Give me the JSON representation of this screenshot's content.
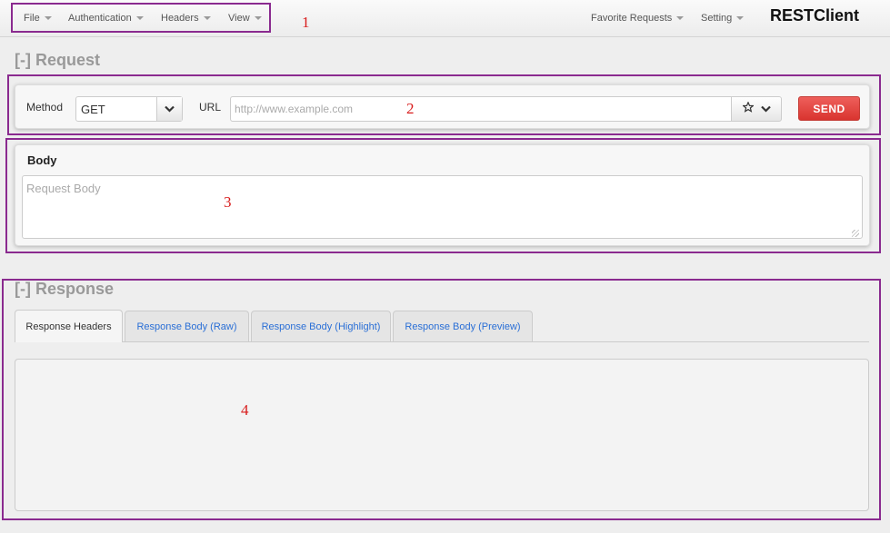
{
  "menu": {
    "left": [
      {
        "label": "File"
      },
      {
        "label": "Authentication"
      },
      {
        "label": "Headers"
      },
      {
        "label": "View"
      }
    ],
    "right": [
      {
        "label": "Favorite Requests"
      },
      {
        "label": "Setting"
      }
    ],
    "brand": "RESTClient"
  },
  "request": {
    "section_title": "[-] Request",
    "method_label": "Method",
    "method_value": "GET",
    "url_label": "URL",
    "url_placeholder": "http://www.example.com",
    "send_label": "SEND",
    "body_title": "Body",
    "body_placeholder": "Request Body"
  },
  "response": {
    "section_title": "[-] Response",
    "tabs": [
      {
        "label": "Response Headers"
      },
      {
        "label": "Response Body (Raw)"
      },
      {
        "label": "Response Body (Highlight)"
      },
      {
        "label": "Response Body (Preview)"
      }
    ]
  },
  "annotations": {
    "markers": [
      "1",
      "2",
      "3",
      "4"
    ],
    "box_color": "#8a2a8f",
    "number_color": "#d81b1b"
  },
  "colors": {
    "send_button": "#d9342f",
    "tab_link": "#2a6fd6",
    "background": "#eeeeee"
  },
  "icons": {
    "dropdown": "chevron-down-icon",
    "favorite": "star-icon",
    "menu_caret": "caret-down-icon"
  }
}
